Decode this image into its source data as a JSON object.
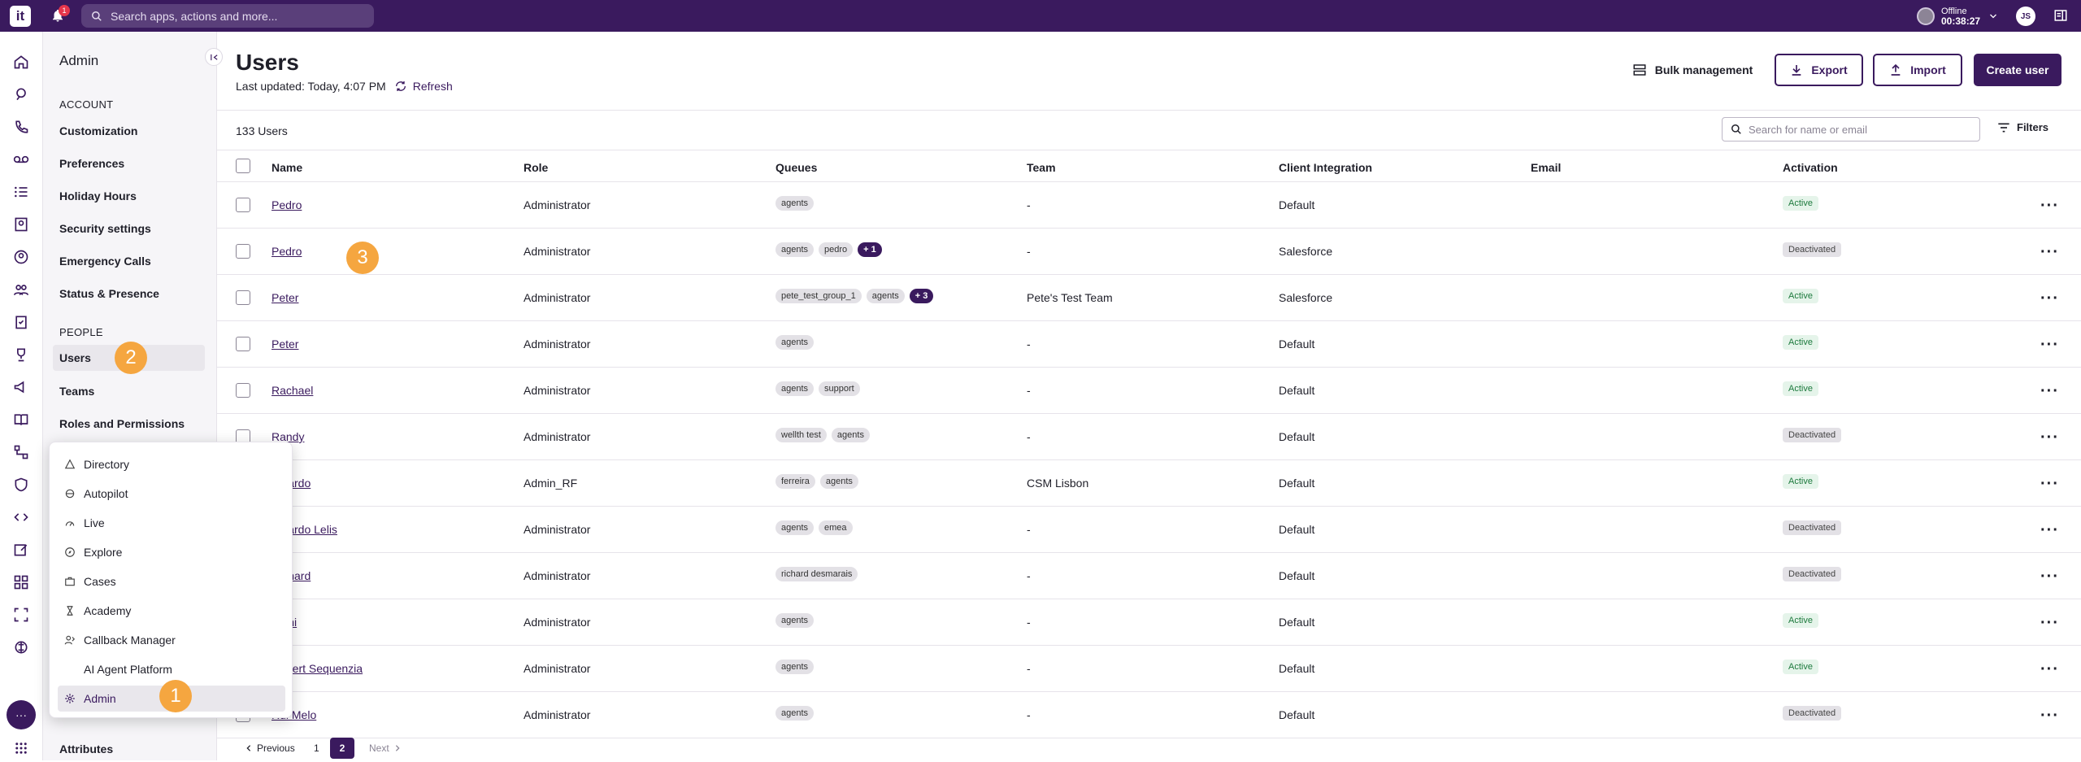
{
  "topbar": {
    "logo": "it",
    "notification_count": "1",
    "search_placeholder": "Search apps, actions and more...",
    "status_label": "Offline",
    "status_time": "00:38:27",
    "avatar_initials": "JS"
  },
  "admin_nav": {
    "title": "Admin",
    "sections": [
      {
        "heading": "ACCOUNT",
        "items": [
          "Customization",
          "Preferences",
          "Holiday Hours",
          "Security settings",
          "Emergency Calls",
          "Status & Presence"
        ]
      },
      {
        "heading": "PEOPLE",
        "items": [
          "Users",
          "Teams",
          "Roles and Permissions"
        ]
      }
    ],
    "bottom_item": "Attributes",
    "active_item": "Users"
  },
  "app_menu": {
    "items": [
      {
        "label": "Directory",
        "icon": "directory-icon"
      },
      {
        "label": "Autopilot",
        "icon": "autopilot-icon"
      },
      {
        "label": "Live",
        "icon": "live-icon"
      },
      {
        "label": "Explore",
        "icon": "explore-icon"
      },
      {
        "label": "Cases",
        "icon": "cases-icon"
      },
      {
        "label": "Academy",
        "icon": "academy-icon"
      },
      {
        "label": "Callback Manager",
        "icon": "callback-icon"
      },
      {
        "label": "AI Agent Platform",
        "icon": "ai-agent-icon"
      },
      {
        "label": "Admin",
        "icon": "gear-icon"
      }
    ],
    "active_item": "Admin"
  },
  "steps": [
    "1",
    "2",
    "3"
  ],
  "page": {
    "title": "Users",
    "last_updated": "Last updated: Today, 4:07 PM",
    "refresh_label": "Refresh",
    "bulk_label": "Bulk management",
    "export_label": "Export",
    "import_label": "Import",
    "create_label": "Create user",
    "user_count": "133 Users",
    "search_placeholder": "Search for name or email",
    "filters_label": "Filters"
  },
  "table": {
    "columns": [
      "Name",
      "Role",
      "Queues",
      "Team",
      "Client Integration",
      "Email",
      "Activation"
    ],
    "rows": [
      {
        "name": "Pedro",
        "role": "Administrator",
        "queues": [
          "agents"
        ],
        "more": "",
        "team": "-",
        "integration": "Default",
        "email": "",
        "activation": "Active"
      },
      {
        "name": "Pedro",
        "role": "Administrator",
        "queues": [
          "agents",
          "pedro"
        ],
        "more": "+ 1",
        "team": "-",
        "integration": "Salesforce",
        "email": "",
        "activation": "Deactivated"
      },
      {
        "name": "Peter",
        "role": "Administrator",
        "queues": [
          "pete_test_group_1",
          "agents"
        ],
        "more": "+ 3",
        "team": "Pete's Test Team",
        "integration": "Salesforce",
        "email": "",
        "activation": "Active"
      },
      {
        "name": "Peter",
        "role": "Administrator",
        "queues": [
          "agents"
        ],
        "more": "",
        "team": "-",
        "integration": "Default",
        "email": "",
        "activation": "Active"
      },
      {
        "name": "Rachael",
        "role": "Administrator",
        "queues": [
          "agents",
          "support"
        ],
        "more": "",
        "team": "-",
        "integration": "Default",
        "email": "",
        "activation": "Active"
      },
      {
        "name": "Randy",
        "role": "Administrator",
        "queues": [
          "wellth test",
          "agents"
        ],
        "more": "",
        "team": "-",
        "integration": "Default",
        "email": "",
        "activation": "Deactivated"
      },
      {
        "name": "Ricardo",
        "role": "Admin_RF",
        "queues": [
          "ferreira",
          "agents"
        ],
        "more": "",
        "team": "CSM Lisbon",
        "integration": "Default",
        "email": "",
        "activation": "Active"
      },
      {
        "name": "Ricardo Lelis",
        "role": "Administrator",
        "queues": [
          "agents",
          "emea"
        ],
        "more": "",
        "team": "-",
        "integration": "Default",
        "email": "",
        "activation": "Deactivated"
      },
      {
        "name": "Richard",
        "role": "Administrator",
        "queues": [
          "richard desmarais"
        ],
        "more": "",
        "team": "-",
        "integration": "Default",
        "email": "",
        "activation": "Deactivated"
      },
      {
        "name": "Rishi",
        "role": "Administrator",
        "queues": [
          "agents"
        ],
        "more": "",
        "team": "-",
        "integration": "Default",
        "email": "",
        "activation": "Active"
      },
      {
        "name": "Robert Sequenzia",
        "role": "Administrator",
        "queues": [
          "agents"
        ],
        "more": "",
        "team": "-",
        "integration": "Default",
        "email": "",
        "activation": "Active"
      },
      {
        "name": "Rui Melo",
        "role": "Administrator",
        "queues": [
          "agents"
        ],
        "more": "",
        "team": "-",
        "integration": "Default",
        "email": "",
        "activation": "Deactivated"
      }
    ]
  },
  "pagination": {
    "previous_label": "Previous",
    "pages": [
      "1",
      "2"
    ],
    "current_page": "2",
    "next_label": "Next"
  },
  "colors": {
    "brand": "#3a1a5e",
    "active_badge": "#1d7a3d",
    "step_marker": "#f5a640"
  }
}
